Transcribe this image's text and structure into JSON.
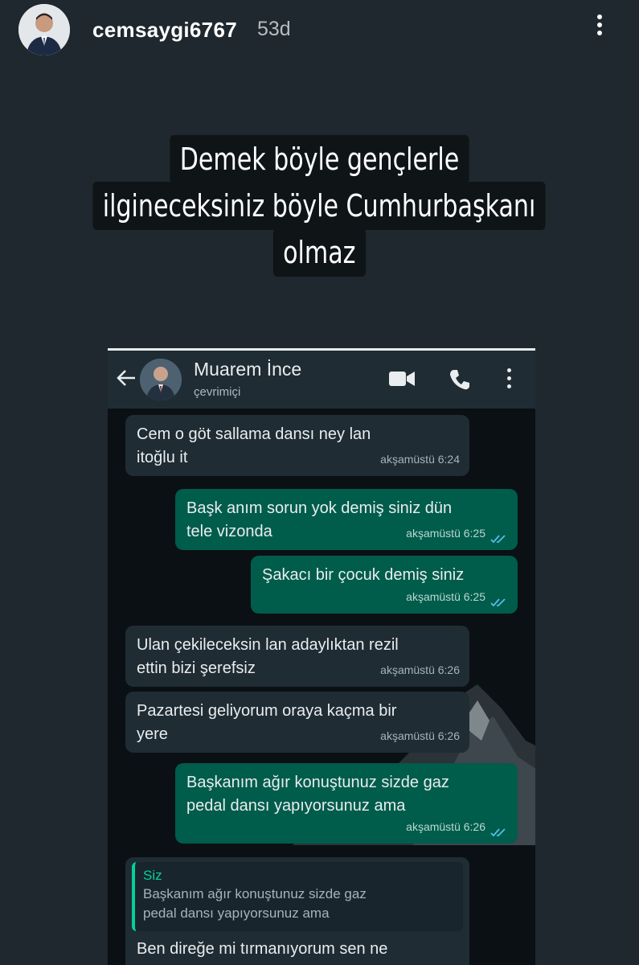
{
  "story": {
    "username": "cemsaygi6767",
    "time_ago": "53d",
    "caption_lines": [
      "Demek böyle gençlerle",
      "ilgineceksiniz böyle Cumhurbaşkanı",
      "olmaz"
    ]
  },
  "chat": {
    "contact_name": "Muarem İnce",
    "contact_status": "çevrimiçi",
    "messages": [
      {
        "dir": "in",
        "lines": [
          "Cem o göt sallama dansı ney lan",
          "itoğlu it"
        ],
        "time": "akşamüstü 6:24"
      },
      {
        "dir": "out",
        "lines": [
          "Başk anım sorun yok demiş siniz dün",
          "tele vizonda"
        ],
        "time": "akşamüstü 6:25"
      },
      {
        "dir": "out",
        "lines": [
          "Şakacı bir çocuk demiş siniz"
        ],
        "time": "akşamüstü 6:25"
      },
      {
        "dir": "in",
        "lines": [
          "Ulan çekileceksin lan adaylıktan rezil",
          "ettin bizi şerefsiz"
        ],
        "time": "akşamüstü 6:26"
      },
      {
        "dir": "in",
        "lines": [
          "Pazartesi geliyorum oraya kaçma bir",
          "yere"
        ],
        "time": "akşamüstü 6:26"
      },
      {
        "dir": "out",
        "lines": [
          "Başkanım ağır konuştunuz sizde gaz",
          "pedal dansı yapıyorsunuz ama"
        ],
        "time": "akşamüstü 6:26"
      }
    ],
    "reply": {
      "quote_author": "Siz",
      "quote_lines": [
        "Başkanım ağır konuştunuz sizde gaz",
        "pedal dansı yapıyorsunuz ama"
      ],
      "partial_text": "Ben direğe mi tırmanıyorum sen ne"
    }
  },
  "colors": {
    "background": "#1f282e",
    "incoming_bubble": "#1f2c33",
    "outgoing_bubble": "#005c4b",
    "read_ticks": "#53bdeb",
    "quote_accent": "#06cf9c"
  },
  "icons": [
    "more-vertical-icon",
    "back-arrow-icon",
    "video-call-icon",
    "phone-icon",
    "read-receipt-icon"
  ]
}
